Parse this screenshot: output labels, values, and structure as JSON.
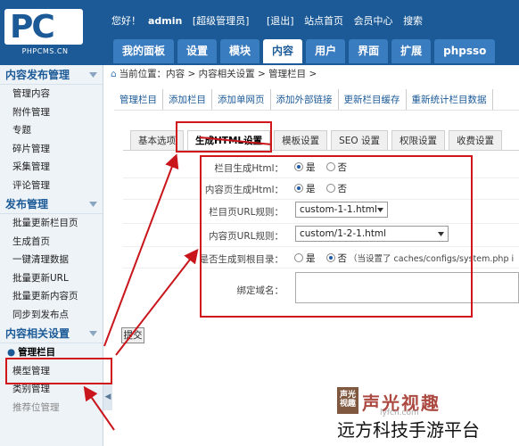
{
  "header": {
    "logo_mark": "PC",
    "logo_text": "PHPCMS.CN",
    "greeting": "您好！",
    "username": "admin",
    "role": "[超级管理员]",
    "logout": "[退出]",
    "site_home": "站点首页",
    "member_center": "会员中心",
    "search": "搜索",
    "nav_tabs": [
      "我的面板",
      "设置",
      "模块",
      "内容",
      "用户",
      "界面",
      "扩展",
      "phpsso"
    ]
  },
  "sidebar": {
    "sections": [
      {
        "title": "内容发布管理",
        "items": [
          "管理内容",
          "附件管理",
          "专题",
          "碎片管理",
          "采集管理",
          "评论管理"
        ]
      },
      {
        "title": "发布管理",
        "items": [
          "批量更新栏目页",
          "生成首页",
          "一键清理数据",
          "批量更新URL",
          "批量更新内容页",
          "同步到发布点"
        ]
      },
      {
        "title": "内容相关设置",
        "items": [
          "管理栏目",
          "模型管理",
          "类别管理",
          "推荐位管理"
        ]
      }
    ],
    "active_item": "管理栏目",
    "collapse_glyph": "◀"
  },
  "breadcrumb": {
    "label": "当前位置：",
    "path": "内容 > 内容相关设置 > 管理栏目 >"
  },
  "subnav": [
    "管理栏目",
    "添加栏目",
    "添加单网页",
    "添加外部链接",
    "更新栏目缓存",
    "重新统计栏目数据"
  ],
  "tabs": [
    "基本选项",
    "生成HTML设置",
    "模板设置",
    "SEO 设置",
    "权限设置",
    "收费设置"
  ],
  "form": {
    "category_html": {
      "label": "栏目生成Html：",
      "options": [
        "是",
        "否"
      ],
      "selected": "是"
    },
    "content_html": {
      "label": "内容页生成Html：",
      "options": [
        "是",
        "否"
      ],
      "selected": "是"
    },
    "category_url": {
      "label": "栏目页URL规则：",
      "value": "custom-1-1.html"
    },
    "content_url": {
      "label": "内容页URL规则：",
      "value": "custom/1-2-1.html"
    },
    "root_dir": {
      "label": "是否生成到根目录：",
      "options": [
        "是",
        "否"
      ],
      "selected": "否",
      "note": "（当设置了 caches/configs/system.php i"
    },
    "domain": {
      "label": "绑定域名：",
      "value": ""
    }
  },
  "submit_label": "提交",
  "watermark": {
    "logo_chars": "声光",
    "logo_sub": "视趣",
    "brand": "声光视趣",
    "url": "lyfcn.com",
    "caption": "远方科技手游平台"
  },
  "colors": {
    "header": "#1b5a97",
    "highlight": "#d0161b",
    "arrow": "#c8161c"
  }
}
